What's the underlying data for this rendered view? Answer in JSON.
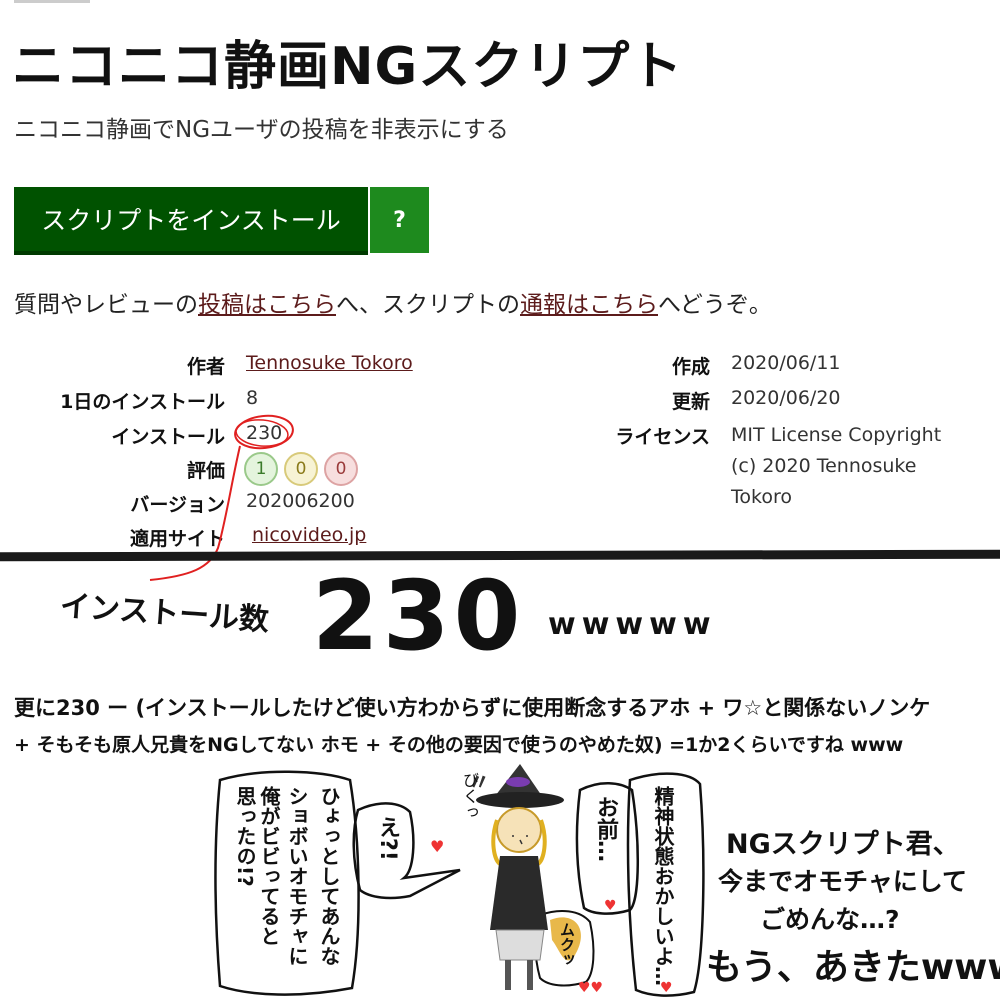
{
  "script": {
    "title": "ニコニコ静画NGスクリプト",
    "description": "ニコニコ静画でNGユーザの投稿を非表示にする",
    "install_label": "スクリプトをインストール",
    "help_label": "?",
    "info_prefix": "質問やレビューの",
    "info_link1": "投稿はこちら",
    "info_mid": "へ、スクリプトの",
    "info_link2": "通報はこちら",
    "info_suffix": "へどうぞ。"
  },
  "meta": {
    "author_label": "作者",
    "author": "Tennosuke Tokoro",
    "daily_label": "1日のインストール",
    "daily": "8",
    "installs_label": "インストール",
    "installs": "230",
    "rating_label": "評価",
    "rating_good": "1",
    "rating_ok": "0",
    "rating_bad": "0",
    "version_label": "バージョン",
    "version": "202006200",
    "site_label": "適用サイト",
    "site": "nicovideo.jp",
    "created_label": "作成",
    "created": "2020/06/11",
    "updated_label": "更新",
    "updated": "2020/06/20",
    "license_label": "ライセンス",
    "license": "MIT License Copyright (c) 2020 Tennosuke Tokoro"
  },
  "comic": {
    "label_installs": "インストール数",
    "big_number": "230",
    "laugh": "wwwww",
    "line1": "更に230 ー (インストールしたけど使い方わからずに使用断念するアホ + ワ☆と関係ないノンケ",
    "line2": "+ そもそも原人兄貴をNGしてない ホモ + その他の要因で使うのやめた奴) =1か2くらいですね www",
    "bubble_left": "思ったの!?",
    "bubble_left2": "俺がビビってると",
    "bubble_left3": "ショボいオモチャに",
    "bubble_left4": "ひょっとしてあんな",
    "bubble_e": "え?!",
    "bubble_right": "お前…",
    "bubble_right2": "精神状態おかしいよ…",
    "sfx_bikuh": "びくっ",
    "sfx_muku": "ムクッ",
    "ng_line1": "NGスクリプト君、",
    "ng_line2": "今までオモチャにして",
    "ng_line3": "ごめんな…?",
    "ng_line4": "もう、あきたwww"
  }
}
